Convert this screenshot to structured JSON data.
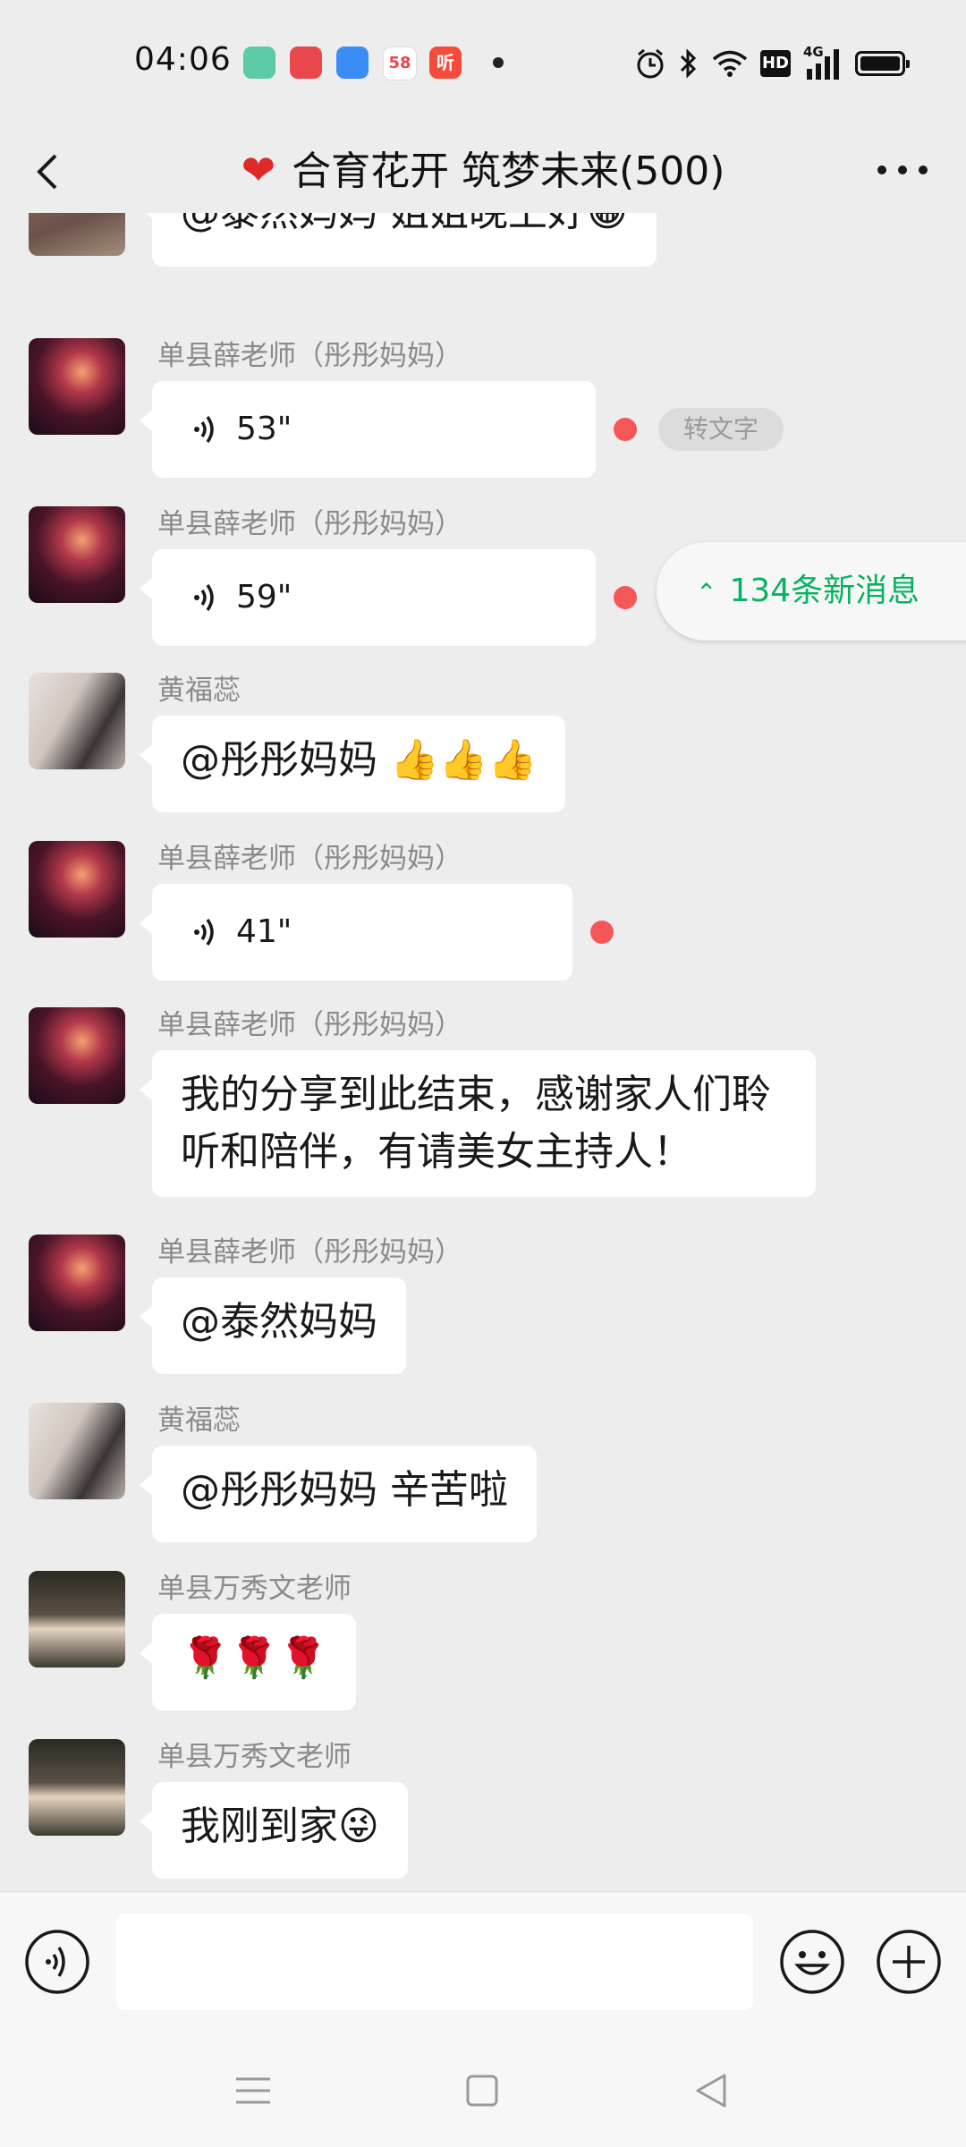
{
  "status_bar": {
    "time": "04:06",
    "app_icons": [
      {
        "name": "app-green-icon",
        "glyph": "",
        "color": "#5cc9a7"
      },
      {
        "name": "app-red-heart-icon",
        "glyph": "",
        "color": "#e8474b"
      },
      {
        "name": "app-blue-icon",
        "glyph": "",
        "color": "#3b8cf5"
      },
      {
        "name": "app-58-icon",
        "glyph": "58",
        "color": "#ffffff"
      },
      {
        "name": "app-listen-icon",
        "glyph": "听",
        "color": "#f44b3b"
      }
    ],
    "network": "4G",
    "hd": "HD"
  },
  "header": {
    "title": "合育花开 筑梦未来(500)",
    "title_icon": "red-heart-icon"
  },
  "new_messages": "134条新消息",
  "transcribe_label": "转文字",
  "messages": [
    {
      "sender": "",
      "text": "@泰然妈妈  姐姐晚上好😁",
      "avatar": "avatar-track"
    },
    {
      "sender": "单县薛老师（彤彤妈妈）",
      "voice": "53\"",
      "unread": true,
      "avatar": "avatar-fireworks"
    },
    {
      "sender": "单县薛老师（彤彤妈妈）",
      "voice": "59\"",
      "unread": true,
      "avatar": "avatar-fireworks"
    },
    {
      "sender": "黄福蕊",
      "text": "@彤彤妈妈  👍👍👍",
      "avatar": "avatar-woman"
    },
    {
      "sender": "单县薛老师（彤彤妈妈）",
      "voice": "41\"",
      "unread": true,
      "avatar": "avatar-fireworks"
    },
    {
      "sender": "单县薛老师（彤彤妈妈）",
      "text_lines": [
        "我的分享到此结束，感谢家人们聆",
        "听和陪伴，有请美女主持人！"
      ],
      "avatar": "avatar-fireworks"
    },
    {
      "sender": "单县薛老师（彤彤妈妈）",
      "text": "@泰然妈妈",
      "avatar": "avatar-fireworks"
    },
    {
      "sender": "黄福蕊",
      "text": "@彤彤妈妈  辛苦啦",
      "avatar": "avatar-woman"
    },
    {
      "sender": "单县万秀文老师",
      "text": "🌹🌹🌹",
      "avatar": "avatar-man"
    },
    {
      "sender": "单县万秀文老师",
      "text": "我刚到家😜",
      "avatar": "avatar-man"
    }
  ],
  "input": {
    "placeholder": "",
    "value": ""
  },
  "colors": {
    "accent": "#07b361",
    "unread": "#f55757",
    "bg": "#ededed"
  }
}
